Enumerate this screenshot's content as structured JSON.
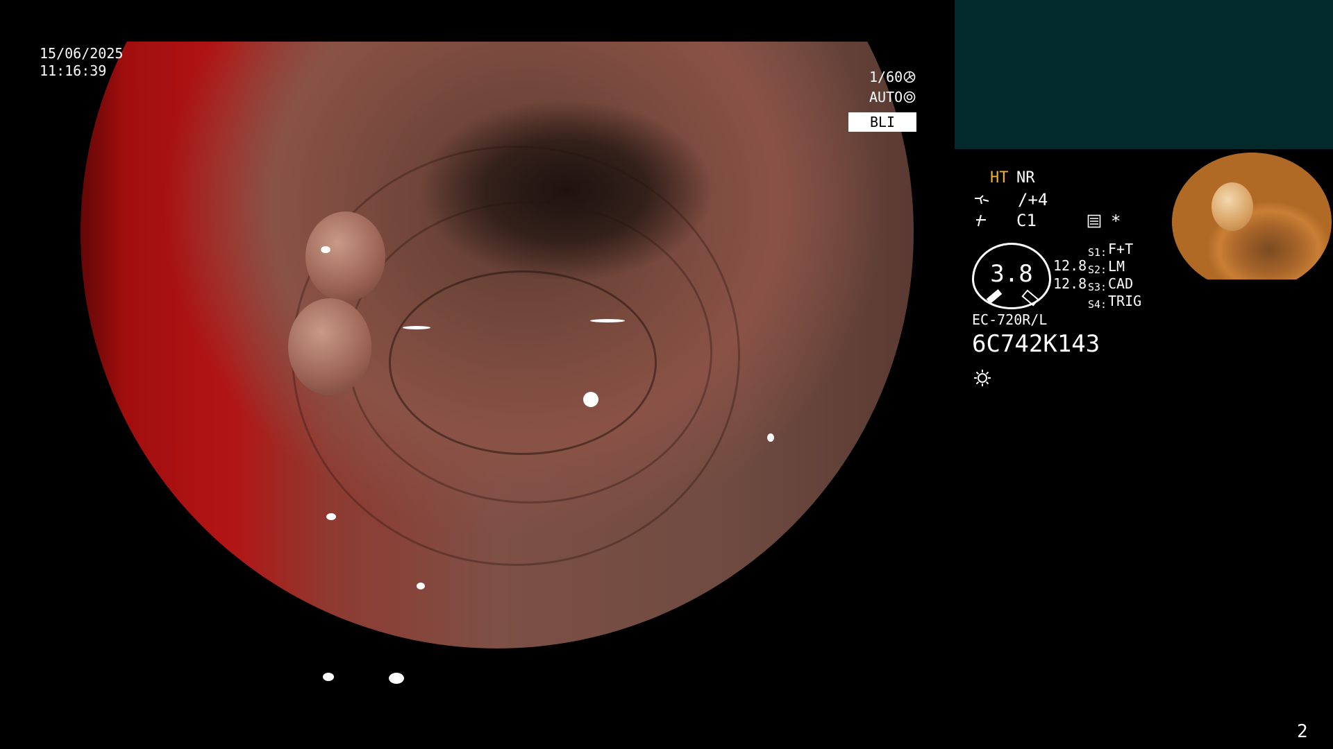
{
  "overlay": {
    "date": "15/06/2025",
    "time": "11:16:39",
    "shutter": "1/60",
    "iris": "AUTO",
    "mode": "BLI",
    "page_number": "2"
  },
  "status_panel": {
    "ht": "HT",
    "nr": "NR",
    "enhancement": "/+4",
    "color": "C1",
    "asterisk": "*",
    "meter_value": "3.8",
    "value_top": "12.8",
    "value_bottom": "12.8",
    "switches": [
      {
        "key": "S1:",
        "value": "F+T"
      },
      {
        "key": "S2:",
        "value": "LM"
      },
      {
        "key": "S3:",
        "value": "CAD"
      },
      {
        "key": "S4:",
        "value": "TRIG"
      }
    ],
    "scope_model": "EC-720R/L",
    "serial": "6C742K143"
  },
  "colors": {
    "ht_accent": "#f2b21b",
    "teal_panel": "#022a2a"
  },
  "icons": [
    "shutter-icon",
    "iris-icon",
    "enhancement-icon",
    "color-icon",
    "memo-icon",
    "light-icon"
  ]
}
